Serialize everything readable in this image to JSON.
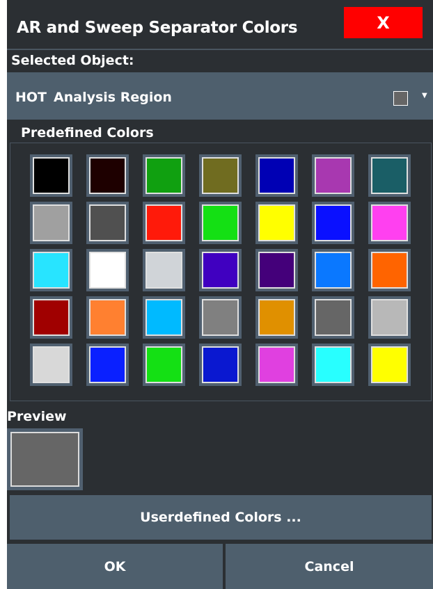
{
  "dialog": {
    "title": "AR and Sweep Separator Colors",
    "close_label": "X"
  },
  "selected_object": {
    "label": "Selected Object:",
    "tag": "HOT",
    "name": "Analysis Region",
    "current_color": "#666666"
  },
  "predefined": {
    "label": "Predefined Colors",
    "colors": [
      [
        "#000000",
        "#1e0000",
        "#10a010",
        "#706c20",
        "#0000b4",
        "#a838b0",
        "#1a5e66"
      ],
      [
        "#a0a0a0",
        "#505050",
        "#ff1a0a",
        "#14e014",
        "#ffff00",
        "#0a10ff",
        "#ff40f0"
      ],
      [
        "#28e4ff",
        "#ffffff",
        "#d0d4d8",
        "#4000c0",
        "#44007a",
        "#0a78ff",
        "#ff6400"
      ],
      [
        "#a00000",
        "#ff8030",
        "#00baff",
        "#808080",
        "#e09000",
        "#666666",
        "#b8b8b8"
      ],
      [
        "#d8d8d8",
        "#0a20ff",
        "#14e014",
        "#0a18d0",
        "#e040e0",
        "#28ffff",
        "#ffff00"
      ]
    ]
  },
  "preview": {
    "label": "Preview",
    "color": "#666666"
  },
  "buttons": {
    "userdefined": "Userdefined Colors ...",
    "ok": "OK",
    "cancel": "Cancel"
  }
}
